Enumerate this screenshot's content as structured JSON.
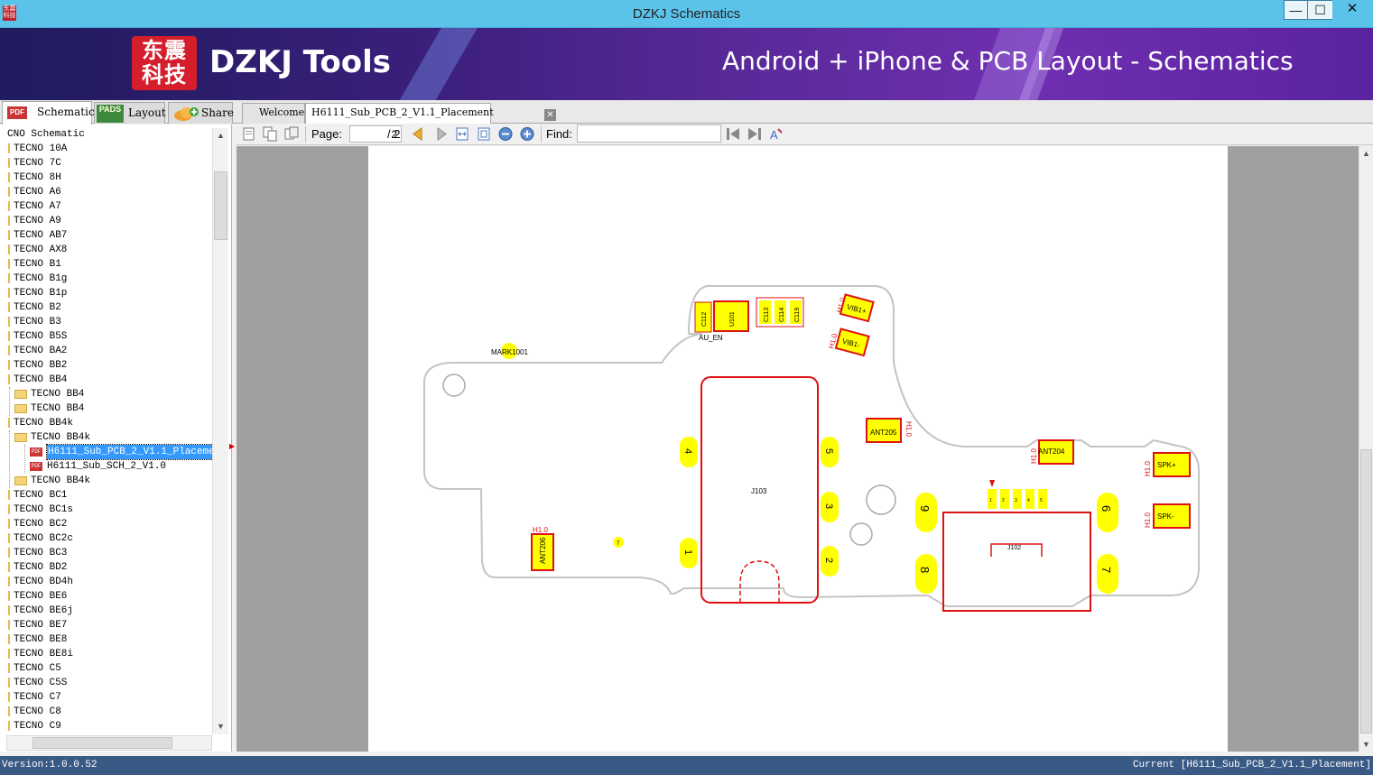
{
  "window": {
    "title": "DZKJ Schematics",
    "app_icon_text": "东震科技",
    "min_glyph": "—",
    "max_glyph": "☐",
    "close_glyph": "✕"
  },
  "banner": {
    "logo_text": "东震科技",
    "brand": "DZKJ Tools",
    "tagline": "Android + iPhone & PCB Layout - Schematics"
  },
  "left_tabs": [
    {
      "label": "Schematic",
      "icon": "pdf-icon",
      "icon_text": "PDF"
    },
    {
      "label": "Layout",
      "icon": "pads-icon",
      "icon_text": "PADS"
    },
    {
      "label": "Share",
      "icon": "cloud-share-icon"
    }
  ],
  "tree": {
    "items": [
      {
        "label": "CNO Schematic",
        "level": 0,
        "kind": "root"
      },
      {
        "label": "TECNO 10A",
        "level": 0,
        "kind": "node"
      },
      {
        "label": "TECNO 7C",
        "level": 0,
        "kind": "node"
      },
      {
        "label": "TECNO 8H",
        "level": 0,
        "kind": "node"
      },
      {
        "label": "TECNO A6",
        "level": 0,
        "kind": "node"
      },
      {
        "label": "TECNO A7",
        "level": 0,
        "kind": "node"
      },
      {
        "label": "TECNO A9",
        "level": 0,
        "kind": "node"
      },
      {
        "label": "TECNO AB7",
        "level": 0,
        "kind": "node"
      },
      {
        "label": "TECNO AX8",
        "level": 0,
        "kind": "node"
      },
      {
        "label": "TECNO B1",
        "level": 0,
        "kind": "node"
      },
      {
        "label": "TECNO B1g",
        "level": 0,
        "kind": "node"
      },
      {
        "label": "TECNO B1p",
        "level": 0,
        "kind": "node"
      },
      {
        "label": "TECNO B2",
        "level": 0,
        "kind": "node"
      },
      {
        "label": "TECNO B3",
        "level": 0,
        "kind": "node"
      },
      {
        "label": "TECNO B5S",
        "level": 0,
        "kind": "node"
      },
      {
        "label": "TECNO BA2",
        "level": 0,
        "kind": "node"
      },
      {
        "label": "TECNO BB2",
        "level": 0,
        "kind": "node"
      },
      {
        "label": "TECNO BB4",
        "level": 0,
        "kind": "node"
      },
      {
        "label": "TECNO BB4",
        "level": 1,
        "kind": "folder"
      },
      {
        "label": "TECNO BB4",
        "level": 1,
        "kind": "folder"
      },
      {
        "label": "TECNO BB4k",
        "level": 0,
        "kind": "node"
      },
      {
        "label": "TECNO BB4k",
        "level": 1,
        "kind": "folder-open"
      },
      {
        "label": "H6111_Sub_PCB_2_V1.1_Placement",
        "level": 2,
        "kind": "pdf",
        "selected": true
      },
      {
        "label": "H6111_Sub_SCH_2_V1.0",
        "level": 2,
        "kind": "pdf"
      },
      {
        "label": "TECNO BB4k",
        "level": 1,
        "kind": "folder"
      },
      {
        "label": "TECNO BC1",
        "level": 0,
        "kind": "node"
      },
      {
        "label": "TECNO BC1s",
        "level": 0,
        "kind": "node"
      },
      {
        "label": "TECNO BC2",
        "level": 0,
        "kind": "node"
      },
      {
        "label": "TECNO BC2c",
        "level": 0,
        "kind": "node"
      },
      {
        "label": "TECNO BC3",
        "level": 0,
        "kind": "node"
      },
      {
        "label": "TECNO BD2",
        "level": 0,
        "kind": "node"
      },
      {
        "label": "TECNO BD4h",
        "level": 0,
        "kind": "node"
      },
      {
        "label": "TECNO BE6",
        "level": 0,
        "kind": "node"
      },
      {
        "label": "TECNO BE6j",
        "level": 0,
        "kind": "node"
      },
      {
        "label": "TECNO BE7",
        "level": 0,
        "kind": "node"
      },
      {
        "label": "TECNO BE8",
        "level": 0,
        "kind": "node"
      },
      {
        "label": "TECNO BE8i",
        "level": 0,
        "kind": "node"
      },
      {
        "label": "TECNO C5",
        "level": 0,
        "kind": "node"
      },
      {
        "label": "TECNO C5S",
        "level": 0,
        "kind": "node"
      },
      {
        "label": "TECNO C7",
        "level": 0,
        "kind": "node"
      },
      {
        "label": "TECNO C8",
        "level": 0,
        "kind": "node"
      },
      {
        "label": "TECNO C9",
        "level": 0,
        "kind": "node"
      }
    ]
  },
  "doc_tabs": [
    {
      "label": "Welcome",
      "active": false
    },
    {
      "label": "H6111_Sub_PCB_2_V1.1_Placement",
      "active": true
    }
  ],
  "doc_tab_close_glyph": "✕",
  "toolbar": {
    "page_label": "Page:",
    "page_value": "2",
    "page_total": "/ 2",
    "find_label": "Find:",
    "find_value": ""
  },
  "pcb": {
    "labels": {
      "mark": "MARK1001",
      "c112": "C112",
      "u101": "U101",
      "au_en": "AU_EN",
      "c113": "C113",
      "c114": "C114",
      "c119": "C119",
      "vib_plus": "VIB1+",
      "vib_minus": "VIB1-",
      "j103": "J103",
      "ant205": "ANT205",
      "ant204": "ANT204",
      "ant206": "ANT206",
      "spk_plus": "SPK+",
      "spk_minus": "SPK-",
      "j102": "J102",
      "h1": "H1.0",
      "dot7": "7",
      "pad1": "1",
      "pad2": "2",
      "pad3": "3",
      "pad4": "4",
      "pad5": "5",
      "pad6": "6",
      "pad7": "7",
      "pad8": "8",
      "pad9": "9",
      "pin1": "1",
      "pin2": "2",
      "pin3": "3",
      "pin4": "4",
      "pin5": "5"
    }
  },
  "status": {
    "version": "Version:1.0.0.52",
    "current": "Current [H6111_Sub_PCB_2_V1.1_Placement]"
  },
  "colors": {
    "titlebar": "#5bc3ea",
    "pad_fill": "#ffff00",
    "pcb_outline": "#c0c0c0",
    "component_red": "#dd1111",
    "status_bg": "#3a5a86",
    "selection": "#3399ff"
  }
}
